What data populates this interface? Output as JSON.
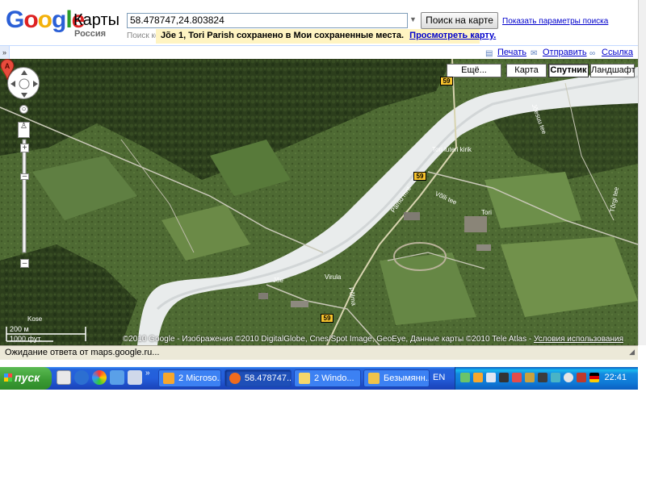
{
  "header": {
    "product": "Карты",
    "country": "Россия",
    "search_value": "58.478747,24.803824",
    "search_button": "Поиск на карте",
    "search_options": "Показать параметры поиска",
    "search_hint": "Поиск ко",
    "notice_text": "Jõe 1, Tori Parish сохранено в Мои сохраненные места.",
    "notice_link": "Просмотреть карту."
  },
  "toolbar": {
    "collapse": "»",
    "print": "Печать",
    "send": "Отправить",
    "link": "Ссылка"
  },
  "map": {
    "more_button": "Ещё...",
    "type_buttons": [
      "Карта",
      "Спутник",
      "Ландшафт"
    ],
    "active_type": "Спутник",
    "scale_metric": "200 м",
    "scale_imperial": "1000 фут.",
    "copyright": "©2010 Google - Изображения ©2010 DigitalGlobe, Cnes/Spot Image, GeoEye, Данные карты ©2010 Tele Atlas - ",
    "terms_link": "Условия использования",
    "marker_label": "A",
    "highway_number": "59",
    "place_labels": [
      "Jõe",
      "Virula",
      "Tori luteri kirik",
      "Tori",
      "Kose"
    ],
    "road_labels": [
      "Pärnu mnt",
      "Võlli tee",
      "Jõesuu tee",
      "Tõrgi tee",
      "Põlma"
    ]
  },
  "status": {
    "text": "Ожидание ответа от maps.google.ru..."
  },
  "taskbar": {
    "start": "пуск",
    "tasks": [
      "2 Microso...",
      "58.478747...",
      "2 Windo...",
      "Безымянн..."
    ],
    "active_task_index": 1,
    "language": "EN",
    "clock": "22:41"
  }
}
